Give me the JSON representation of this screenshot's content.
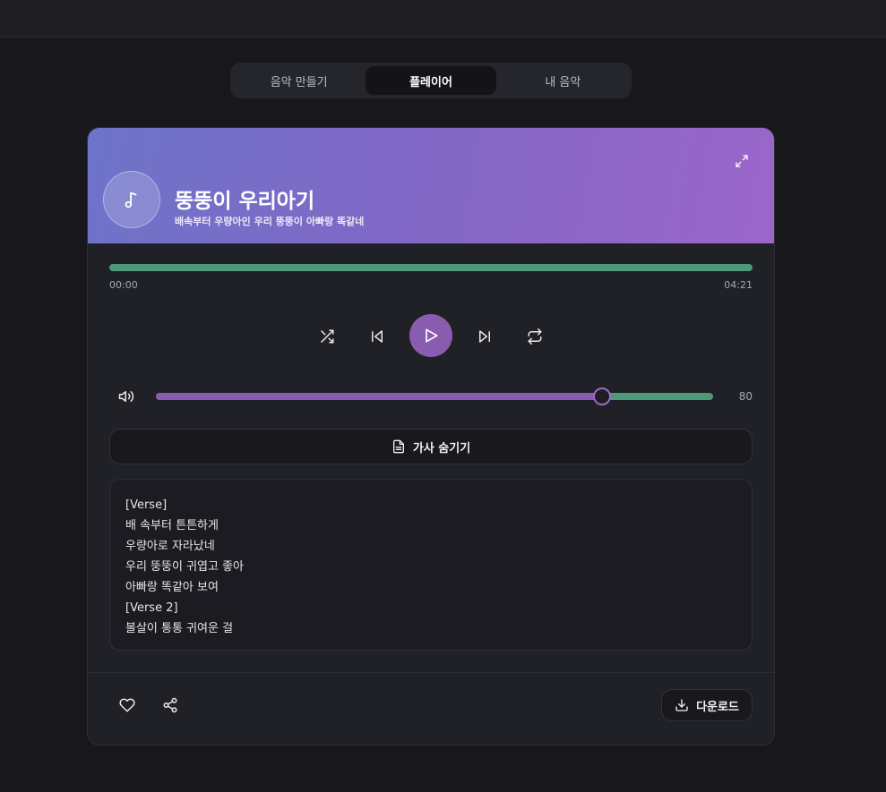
{
  "tabs": [
    {
      "label": "음악 만들기",
      "active": false
    },
    {
      "label": "플레이어",
      "active": true
    },
    {
      "label": "내 음악",
      "active": false
    }
  ],
  "player": {
    "title": "뚱뚱이 우리아기",
    "subtitle": "배속부터 우량아인 우리 뚱뚱이 아빠랑 똑같네",
    "current_time": "00:00",
    "duration": "04:21",
    "progress": 1.0,
    "volume": 80,
    "volume_display": "80"
  },
  "lyrics_toggle_label": "가사 숨기기",
  "lyrics": [
    "[Verse]",
    "배 속부터 튼튼하게",
    "우량아로 자라났네",
    "우리 뚱뚱이 귀엽고 좋아",
    "아빠랑 똑같아 보여",
    "[Verse 2]",
    "볼살이 통통 귀여운 걸"
  ],
  "download_label": "다운로드",
  "colors": {
    "accent_purple": "#8a5cb0",
    "accent_green": "#4e9a78",
    "background": "#18181c",
    "card": "#202027"
  },
  "icons": {
    "music_note": "music-note-icon",
    "expand": "expand-icon",
    "shuffle": "shuffle-icon",
    "previous": "skip-previous-icon",
    "play": "play-icon",
    "next": "skip-next-icon",
    "repeat": "repeat-icon",
    "volume": "volume-icon",
    "lyrics": "document-icon",
    "like": "heart-icon",
    "share": "share-icon",
    "download": "download-icon"
  }
}
